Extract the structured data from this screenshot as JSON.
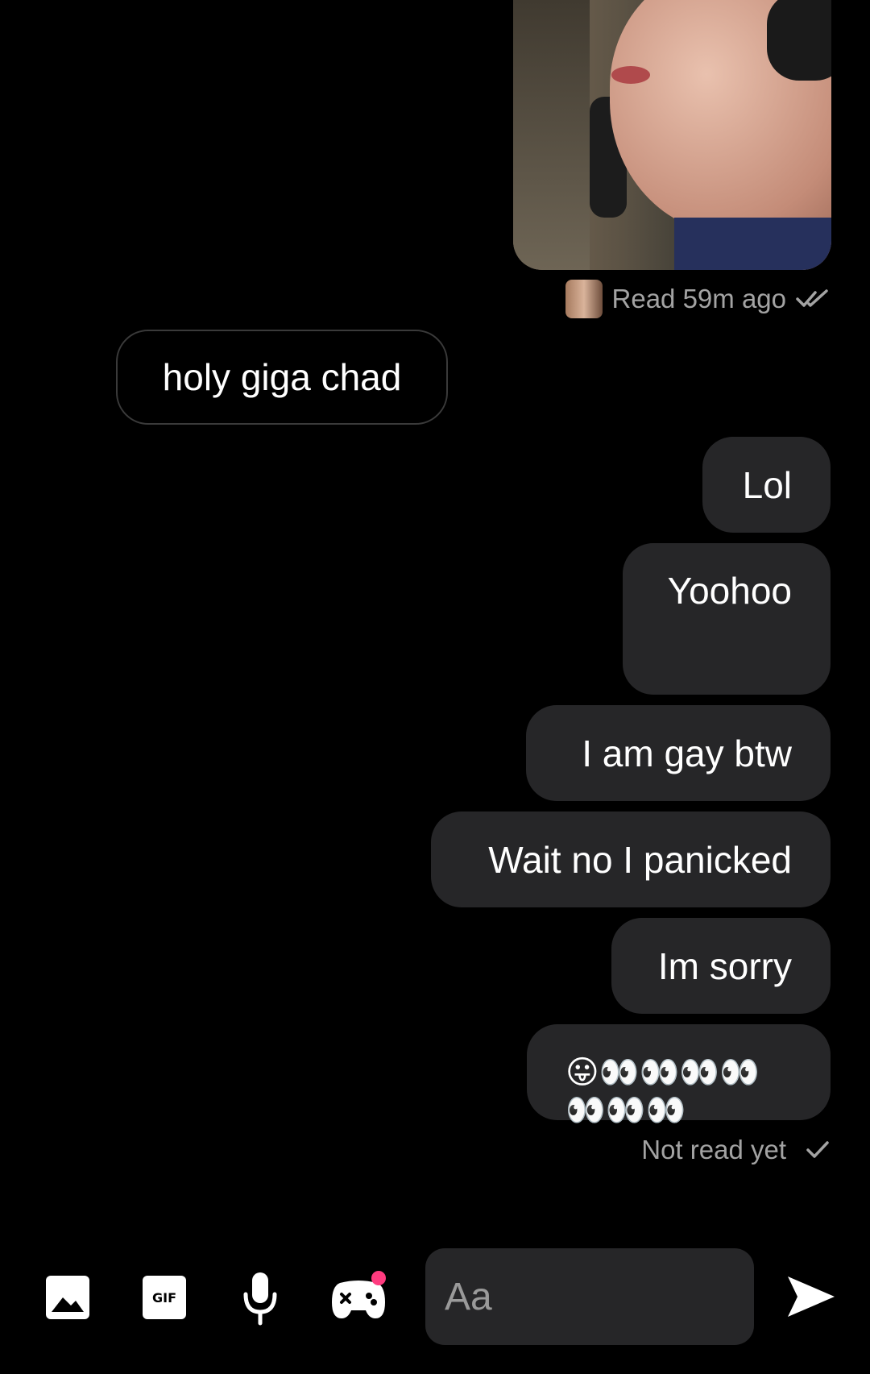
{
  "conversation": {
    "photo_label": "sent-photo",
    "read_receipt": "Read 59m ago",
    "incoming": [
      {
        "text": "holy giga chad"
      }
    ],
    "outgoing": [
      {
        "text": "Lol"
      },
      {
        "text": "Yoohoo"
      },
      {
        "text": "I am gay btw"
      },
      {
        "text": "Wait no I panicked"
      },
      {
        "text": "Im sorry"
      },
      {
        "text": "😛👀👀👀👀👀👀👀"
      }
    ],
    "status": "Not read yet"
  },
  "composer": {
    "placeholder": "Aa",
    "gif_label": "GIF"
  },
  "colors": {
    "background": "#000000",
    "outgoing_bubble": "#262628",
    "muted_text": "#a3a3a3",
    "notification_dot": "#ff3b7f"
  },
  "icons": [
    "image-icon",
    "gif-icon",
    "microphone-icon",
    "game-controller-icon",
    "send-icon",
    "double-check-icon",
    "check-icon"
  ]
}
